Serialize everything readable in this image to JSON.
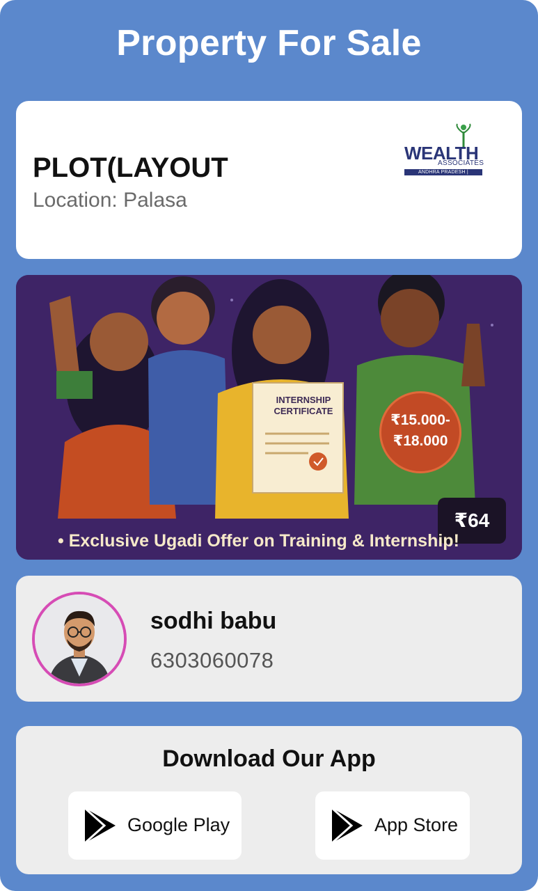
{
  "header": {
    "title": "Property For Sale"
  },
  "property": {
    "name": "PLOT(LAYOUT",
    "location": "Location: Palasa",
    "logo": {
      "wordmark": "WEALTH",
      "subtitle": "ASSOCIATES",
      "region": "ANDHRA PRADESH | TELANGANA"
    }
  },
  "banner": {
    "certificate_title": "INTERNSHIP CERTIFICATE",
    "salary_range_line1": "₹15.000-",
    "salary_range_line2": "₹18.000",
    "price": "₹64",
    "caption": "Exclusive Ugadi Offer on Training & Internship!",
    "colors": {
      "background": "#3e2466",
      "badge": "#c24a25"
    }
  },
  "agent": {
    "name": "sodhi babu",
    "phone": "6303060078",
    "avatar_icon": "person-avatar"
  },
  "download": {
    "title": "Download Our App",
    "google_play_label": "Google Play",
    "app_store_label": "App Store",
    "icon": "play-triangle-icon"
  },
  "colors": {
    "page_background": "#5b88cc",
    "avatar_ring": "#d64cb5"
  }
}
